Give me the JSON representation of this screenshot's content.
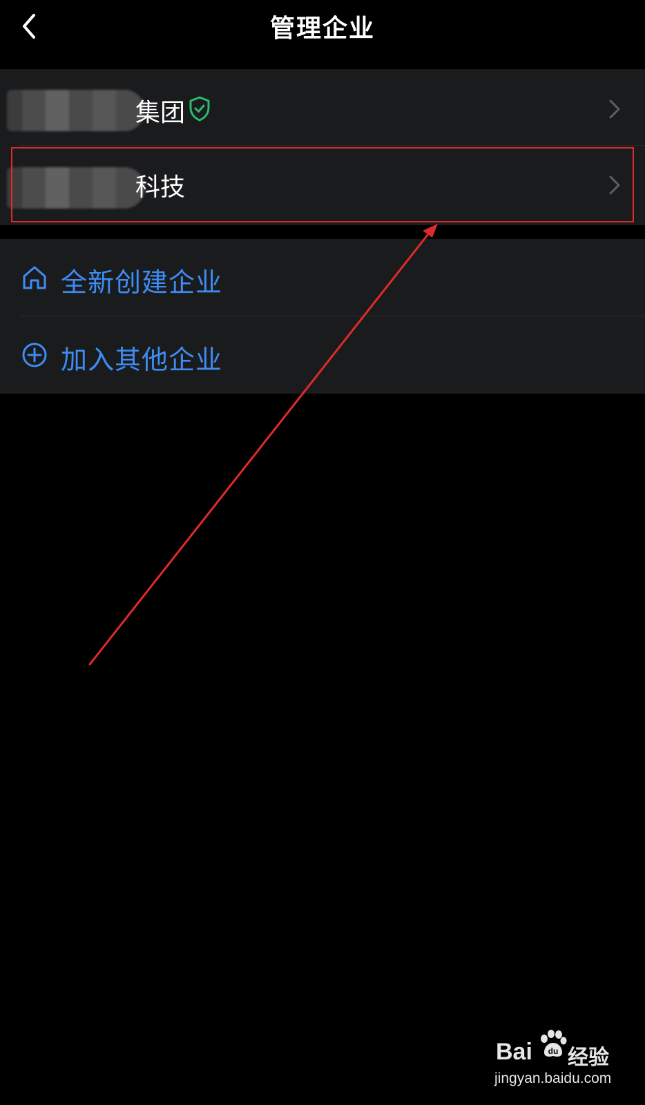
{
  "header": {
    "title": "管理企业"
  },
  "companies": [
    {
      "name_suffix": "集团",
      "verified": true
    },
    {
      "name_suffix": "科技",
      "verified": false
    }
  ],
  "actions": [
    {
      "label": "全新创建企业",
      "icon": "home-icon"
    },
    {
      "label": "加入其他企业",
      "icon": "plus-circle-icon"
    }
  ],
  "watermark": {
    "brand": "Bai",
    "brand_suffix": "经验",
    "url": "jingyan.baidu.com"
  },
  "colors": {
    "background": "#000000",
    "list_bg": "#1a1b1d",
    "accent_blue": "#3d8df5",
    "verified_green": "#2dbb6a",
    "annotation_red": "#e02a2a"
  }
}
